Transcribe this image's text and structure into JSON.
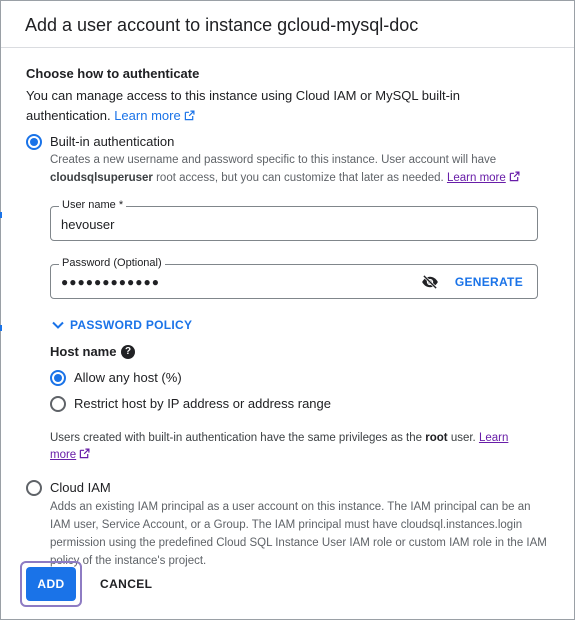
{
  "dialog": {
    "title": "Add a user account to instance gcloud-mysql-doc"
  },
  "auth": {
    "heading": "Choose how to authenticate",
    "intro_text": "You can manage access to this instance using Cloud IAM or MySQL built-in authentication.",
    "intro_link": "Learn more",
    "selected": "builtin",
    "builtin": {
      "label": "Built-in authentication",
      "helper_pre": "Creates a new username and password specific to this instance. User account will have",
      "helper_bold": "cloudsqlsuperuser",
      "helper_post": "root access, but you can customize that later as needed.",
      "helper_link": "Learn more",
      "username": {
        "label": "User name *",
        "value": "hevouser"
      },
      "password": {
        "label": "Password (Optional)",
        "value": "●●●●●●●●●●●●",
        "generate_label": "GENERATE",
        "visibility_icon": "visibility-off-icon"
      },
      "password_policy_label": "PASSWORD POLICY",
      "host_name": {
        "label": "Host name",
        "options": [
          {
            "label": "Allow any host (%)",
            "selected": true
          },
          {
            "label": "Restrict host by IP address or address range",
            "selected": false
          }
        ]
      },
      "note_pre": "Users created with built-in authentication have the same privileges as the",
      "note_bold": "root",
      "note_post": "user.",
      "note_link_1": "Learn",
      "note_link_2": "more"
    },
    "cloud_iam": {
      "label": "Cloud IAM",
      "helper": "Adds an existing IAM principal as a user account on this instance. The IAM principal can be an IAM user, Service Account, or a Group. The IAM principal must have cloudsql.instances.login permission using the predefined Cloud SQL Instance User IAM role or custom IAM role in the IAM policy of the instance's project."
    }
  },
  "actions": {
    "add_label": "ADD",
    "cancel_label": "CANCEL"
  },
  "colors": {
    "accent": "#1a73e8",
    "link_visited": "#681da8",
    "focus_ring": "#8e7cc3"
  }
}
